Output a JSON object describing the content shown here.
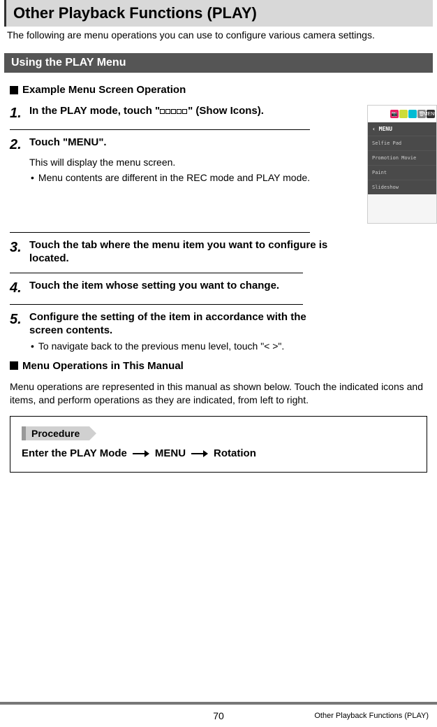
{
  "title": "Other Playback Functions (PLAY)",
  "intro": "The following are menu operations you can use to configure various camera settings.",
  "section_header": "Using the PLAY Menu",
  "sub_heading_1": "Example Menu Screen Operation",
  "steps": [
    {
      "num": "1.",
      "head_pre": "In the PLAY mode, touch \"",
      "head_post": "\" (Show Icons).",
      "body": "",
      "bullets": []
    },
    {
      "num": "2.",
      "head": "Touch \"MENU\".",
      "body": "This will display the menu screen.",
      "bullets": [
        "Menu contents are different in the REC mode and PLAY mode."
      ]
    },
    {
      "num": "3.",
      "head": "Touch the tab where the menu item you want to configure is located.",
      "body": "",
      "bullets": []
    },
    {
      "num": "4.",
      "head": "Touch the item whose setting you want to change.",
      "body": "",
      "bullets": []
    },
    {
      "num": "5.",
      "head": "Configure the setting of the item in accordance with the screen contents.",
      "body": "",
      "bullets": [
        "To navigate back to the previous menu level, touch \"< >\"."
      ]
    }
  ],
  "sub_heading_2": "Menu Operations in This Manual",
  "explain": "Menu operations are represented in this manual as shown below. Touch the indicated icons and items, and perform operations as they are indicated, from left to right.",
  "procedure_label": "Procedure",
  "procedure_path": [
    "Enter the PLAY Mode",
    "MENU",
    "Rotation"
  ],
  "screenshot": {
    "header": "‹   MENU",
    "items": [
      "Selfie Pad",
      "Promotion Movie",
      "Paint",
      "Slideshow"
    ],
    "menu_badge": "MENU"
  },
  "footer": {
    "page": "70",
    "right": "Other Playback Functions (PLAY)"
  }
}
